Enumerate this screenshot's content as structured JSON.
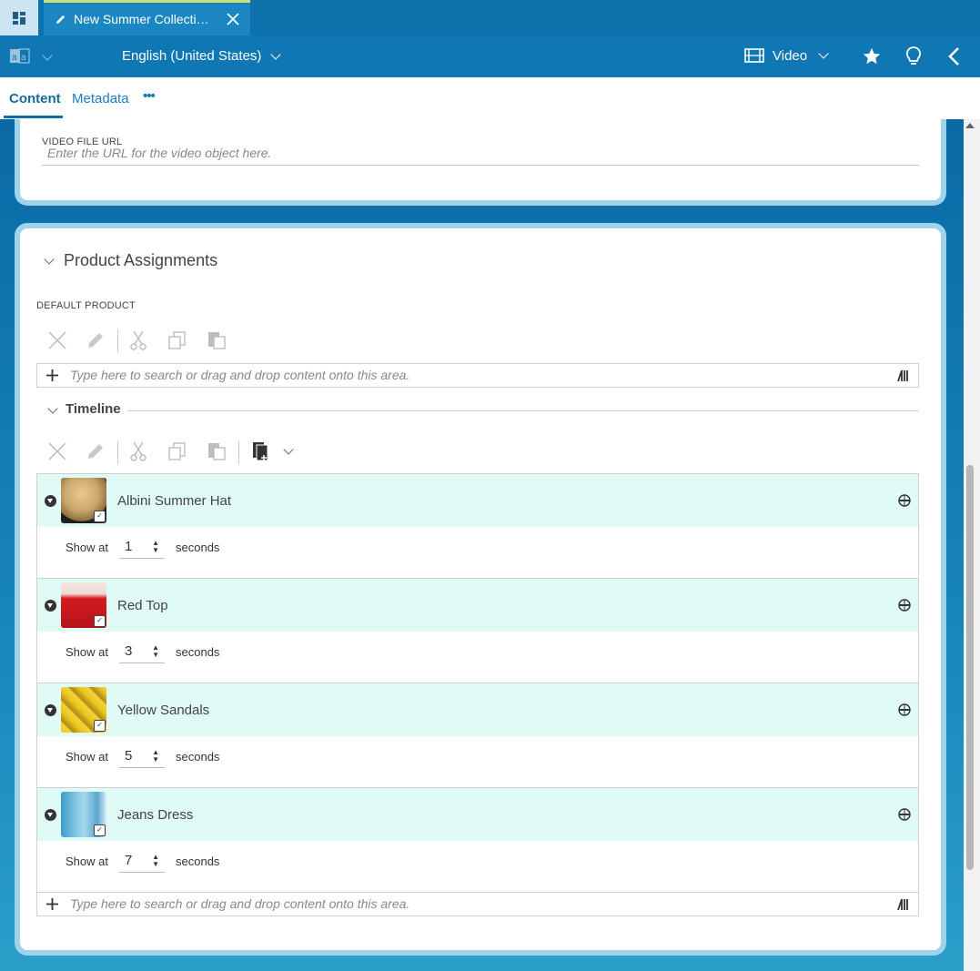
{
  "header": {
    "tab_title": "New Summer Collecti…"
  },
  "toolbar": {
    "locale": "English (United States)",
    "content_type": "Video"
  },
  "tabs": [
    {
      "label": "Content",
      "active": true
    },
    {
      "label": "Metadata",
      "active": false
    },
    {
      "label": "•••",
      "active": false
    }
  ],
  "video": {
    "url_label": "VIDEO FILE URL",
    "url_placeholder": "Enter the URL for the video object here."
  },
  "product_assignments": {
    "section_title": "Product Assignments",
    "default_product_label": "DEFAULT PRODUCT",
    "dropzone_placeholder": "Type here to search or drag and drop content onto this area.",
    "timeline_title": "Timeline",
    "timeline_items": [
      {
        "name": "Albini Summer Hat",
        "show_at_label": "Show at",
        "value": "1",
        "unit": "seconds"
      },
      {
        "name": "Red Top",
        "show_at_label": "Show at",
        "value": "3",
        "unit": "seconds"
      },
      {
        "name": "Yellow Sandals",
        "show_at_label": "Show at",
        "value": "5",
        "unit": "seconds"
      },
      {
        "name": "Jeans Dress",
        "show_at_label": "Show at",
        "value": "7",
        "unit": "seconds"
      }
    ],
    "timeline_dropzone_placeholder": "Type here to search or drag and drop content onto this area."
  },
  "colors": {
    "header_bg": "#0e72ad",
    "accent": "#1a7fbf",
    "row_highlight": "#e0fbf6",
    "panel_border": "#9fd3ec"
  }
}
